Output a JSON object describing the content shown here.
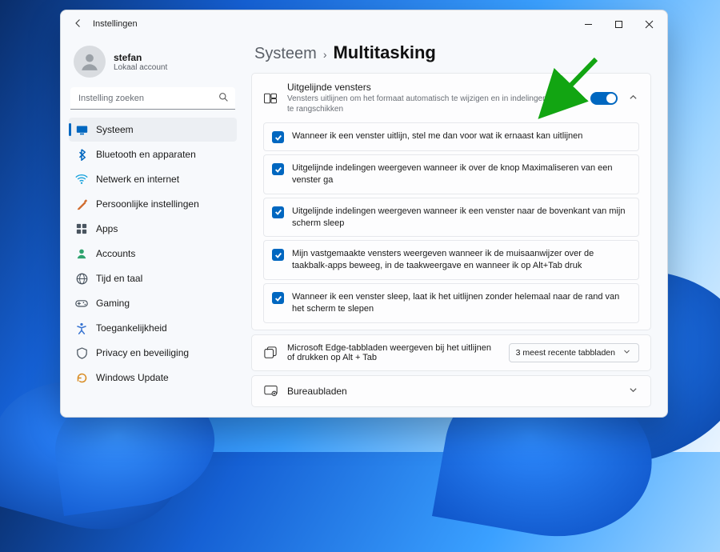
{
  "window": {
    "title": "Instellingen"
  },
  "user": {
    "name": "stefan",
    "subtitle": "Lokaal account"
  },
  "search": {
    "placeholder": "Instelling zoeken"
  },
  "sidebar": {
    "items": [
      {
        "label": "Systeem",
        "icon": "display",
        "color": "#0067c0",
        "selected": true
      },
      {
        "label": "Bluetooth en apparaten",
        "icon": "bluetooth",
        "color": "#0067c0",
        "selected": false
      },
      {
        "label": "Netwerk en internet",
        "icon": "wifi",
        "color": "#1aa3dd",
        "selected": false
      },
      {
        "label": "Persoonlijke instellingen",
        "icon": "paint",
        "color": "#d06a2c",
        "selected": false
      },
      {
        "label": "Apps",
        "icon": "apps",
        "color": "#4a5560",
        "selected": false
      },
      {
        "label": "Accounts",
        "icon": "person",
        "color": "#2fa36f",
        "selected": false
      },
      {
        "label": "Tijd en taal",
        "icon": "clock-globe",
        "color": "#4a5560",
        "selected": false
      },
      {
        "label": "Gaming",
        "icon": "gamepad",
        "color": "#4a5560",
        "selected": false
      },
      {
        "label": "Toegankelijkheid",
        "icon": "accessibility",
        "color": "#3773d1",
        "selected": false
      },
      {
        "label": "Privacy en beveiliging",
        "icon": "shield",
        "color": "#4a5560",
        "selected": false
      },
      {
        "label": "Windows Update",
        "icon": "update",
        "color": "#d88a1f",
        "selected": false
      }
    ]
  },
  "breadcrumb": {
    "parent": "Systeem",
    "separator": "›",
    "current": "Multitasking"
  },
  "snap": {
    "title": "Uitgelijnde vensters",
    "subtitle": "Vensters uitlijnen om het formaat automatisch te wijzigen en in indelingen te rangschikken",
    "toggle_label": "Aan",
    "toggle_on": true,
    "expanded": true,
    "options": [
      {
        "checked": true,
        "text": "Wanneer ik een venster uitlijn, stel me dan voor wat ik ernaast kan uitlijnen"
      },
      {
        "checked": true,
        "text": "Uitgelijnde indelingen weergeven wanneer ik over de knop Maximaliseren van een venster ga"
      },
      {
        "checked": true,
        "text": "Uitgelijnde indelingen weergeven wanneer ik een venster naar de bovenkant van mijn scherm sleep"
      },
      {
        "checked": true,
        "text": "Mijn vastgemaakte vensters weergeven wanneer ik de muisaanwijzer over de taakbalk-apps beweeg, in de taakweergave en wanneer ik op Alt+Tab druk"
      },
      {
        "checked": true,
        "text": "Wanneer ik een venster sleep, laat ik het uitlijnen zonder helemaal naar de rand van het scherm te slepen"
      }
    ]
  },
  "edge_tabs": {
    "text": "Microsoft Edge-tabbladen weergeven bij het uitlijnen of drukken op Alt + Tab",
    "dropdown_value": "3 meest recente tabbladen"
  },
  "desktops": {
    "title": "Bureaubladen"
  }
}
